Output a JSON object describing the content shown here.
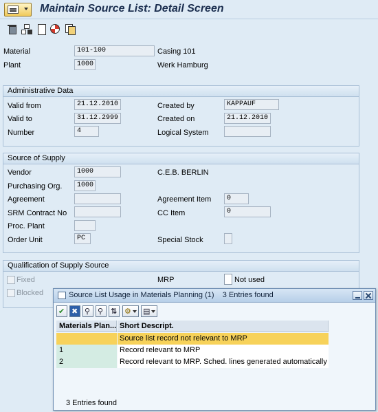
{
  "app": {
    "title": "Maintain Source List: Detail Screen"
  },
  "header": {
    "material_label": "Material",
    "material_value": "101-100",
    "material_desc": "Casing 101",
    "plant_label": "Plant",
    "plant_value": "1000",
    "plant_desc": "Werk Hamburg"
  },
  "admin": {
    "title": "Administrative Data",
    "valid_from_label": "Valid from",
    "valid_from": "21.12.2010",
    "valid_to_label": "Valid to",
    "valid_to": "31.12.2999",
    "number_label": "Number",
    "number": "4",
    "created_by_label": "Created by",
    "created_by": "KAPPAUF",
    "created_on_label": "Created on",
    "created_on": "21.12.2010",
    "logical_system_label": "Logical System",
    "logical_system": ""
  },
  "supply": {
    "title": "Source of Supply",
    "vendor_label": "Vendor",
    "vendor": "1000",
    "vendor_desc": "C.E.B. BERLIN",
    "porg_label": "Purchasing Org.",
    "porg": "1000",
    "agreement_label": "Agreement",
    "agreement": "",
    "agreement_item_label": "Agreement Item",
    "agreement_item": "0",
    "srm_label": "SRM Contract No",
    "srm": "",
    "cc_item_label": "CC Item",
    "cc_item": "0",
    "proc_plant_label": "Proc. Plant",
    "proc_plant": "",
    "order_unit_label": "Order Unit",
    "order_unit": "PC",
    "special_stock_label": "Special Stock",
    "special_stock": ""
  },
  "qualification": {
    "title": "Qualification of Supply Source",
    "fixed_label": "Fixed",
    "blocked_label": "Blocked",
    "mrp_label": "MRP",
    "mrp_value": "",
    "mrp_desc": "Not used"
  },
  "popup": {
    "title_part1": "Source List Usage in Materials Planning (1)",
    "title_part2": "3 Entries found",
    "col1": "Materials Plan...",
    "col2": "Short Descript.",
    "rows": [
      {
        "code": "",
        "desc": "Source list record not relevant to MRP"
      },
      {
        "code": "1",
        "desc": "Record relevant to MRP"
      },
      {
        "code": "2",
        "desc": "Record relevant to MRP. Sched. lines generated automatically"
      }
    ],
    "status": "3 Entries found",
    "buttons": {
      "ok": "✔",
      "cancel": "✖",
      "find": "⚲",
      "find_next": "⚲",
      "sort": "⇅",
      "settings": "⚙",
      "print": "▤"
    }
  },
  "colors": {
    "background": "#dfebf5",
    "selected_row": "#f7d25a",
    "key_column": "#d4ece3"
  },
  "icons": [
    "trash-icon",
    "hierarchy-icon",
    "new-document-icon",
    "help-lifebuoy-icon",
    "copy-icon"
  ]
}
